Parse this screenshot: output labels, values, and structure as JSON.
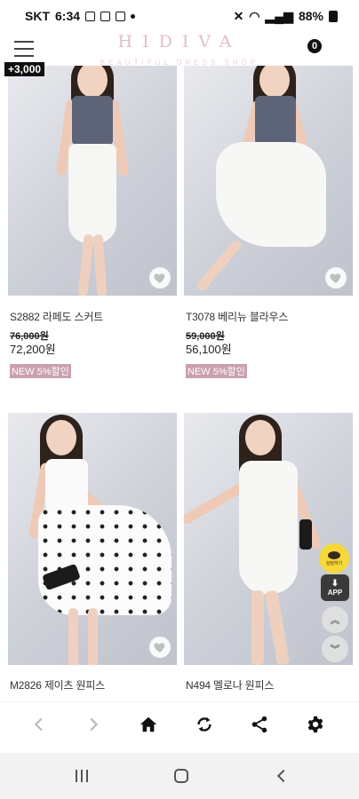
{
  "status_bar": {
    "carrier": "SKT",
    "time": "6:34",
    "battery": "88%"
  },
  "header": {
    "brand": "HIDIVA",
    "brand_sub": "BEAUTIFUL DRESS SHOP",
    "cart_count": "0",
    "points_badge": "+3,000"
  },
  "products": [
    {
      "name": "S2882 라페도 스커트",
      "original_price": "76,000원",
      "sale_price": "72,200원",
      "promo": "NEW 5%할인"
    },
    {
      "name": "T3078 베리뉴 블라우스",
      "original_price": "59,000원",
      "sale_price": "56,100원",
      "promo": "NEW 5%할인"
    },
    {
      "name": "M2826 제이츠 원피스"
    },
    {
      "name": "N494 멜로나 원피스"
    }
  ],
  "side_buttons": {
    "kakao_label": "상담하기",
    "app_label": "APP"
  },
  "toolbar": {
    "icons": [
      "back-arrow-icon",
      "forward-arrow-icon",
      "home-icon",
      "refresh-icon",
      "share-icon",
      "settings-gear-icon"
    ]
  },
  "colors": {
    "promo_tag": "#caa0ad",
    "brand": "#e3bccd",
    "kakao": "#f7d83a"
  }
}
